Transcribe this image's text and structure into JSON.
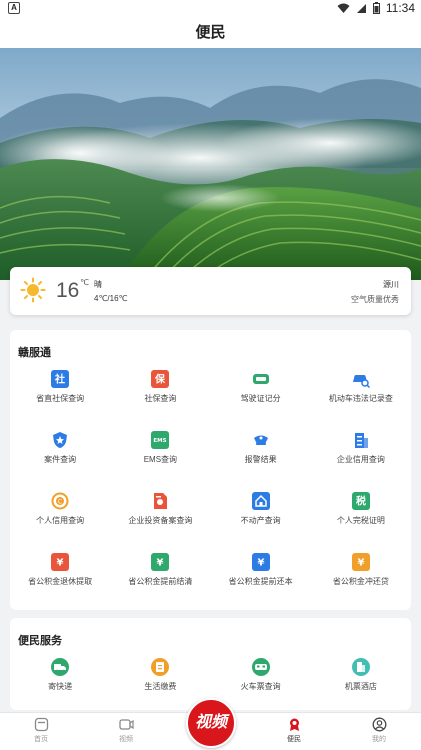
{
  "statusbar": {
    "left_icon": "A",
    "time": "11:34"
  },
  "header": {
    "title": "便民"
  },
  "weather": {
    "icon": "sun-icon",
    "temperature": "16",
    "unit": "℃",
    "condition": "晴",
    "range": "4℃/16℃",
    "city": "源川",
    "air_quality": "空气质量优秀"
  },
  "ganfutong": {
    "title": "赣服通",
    "items": [
      {
        "label": "省直社保查询",
        "icon": "社",
        "color": "#2d7be5"
      },
      {
        "label": "社保查询",
        "icon": "保",
        "color": "#e8553b"
      },
      {
        "label": "驾驶证记分",
        "icon": "car-card-icon",
        "color": "#2fa86e"
      },
      {
        "label": "机动车违法记录查",
        "icon": "car-search-icon",
        "color": "#2d7be5"
      },
      {
        "label": "案件查询",
        "icon": "badge-icon",
        "color": "#2d7be5"
      },
      {
        "label": "EMS查询",
        "icon": "EMS",
        "color": "#2fa86e"
      },
      {
        "label": "报警结果",
        "icon": "police-hat-icon",
        "color": "#2d7be5"
      },
      {
        "label": "企业信用查询",
        "icon": "building-icon",
        "color": "#2d7be5"
      },
      {
        "label": "个人信用查询",
        "icon": "credit-icon",
        "color": "#f0a02a"
      },
      {
        "label": "企业投资备案查询",
        "icon": "document-icon",
        "color": "#e8553b"
      },
      {
        "label": "不动产查询",
        "icon": "house-icon",
        "color": "#2d7be5"
      },
      {
        "label": "个人完税证明",
        "icon": "税",
        "color": "#2fa86e"
      },
      {
        "label": "省公积金退休提取",
        "icon": "¥",
        "color": "#e8553b"
      },
      {
        "label": "省公积金提前结清",
        "icon": "¥",
        "color": "#2fa86e"
      },
      {
        "label": "省公积金提前还本",
        "icon": "¥",
        "color": "#2d7be5"
      },
      {
        "label": "省公积金冲还贷",
        "icon": "¥",
        "color": "#f0a02a"
      }
    ]
  },
  "bianmin": {
    "title": "便民服务",
    "items": [
      {
        "label": "寄快递",
        "icon": "truck-icon",
        "color": "#2fa86e"
      },
      {
        "label": "生活缴费",
        "icon": "bill-icon",
        "color": "#f0a02a"
      },
      {
        "label": "火车票查询",
        "icon": "train-icon",
        "color": "#2fa86e"
      },
      {
        "label": "机票酒店",
        "icon": "hotel-icon",
        "color": "#44bdb3"
      }
    ]
  },
  "tabbar": {
    "items": [
      {
        "label": "首页",
        "icon": "home-icon"
      },
      {
        "label": "视频",
        "icon": "video-icon"
      },
      {
        "label": "视频",
        "icon": "shixin-logo"
      },
      {
        "label": "便民",
        "icon": "service-icon"
      },
      {
        "label": "我的",
        "icon": "profile-icon"
      }
    ]
  }
}
